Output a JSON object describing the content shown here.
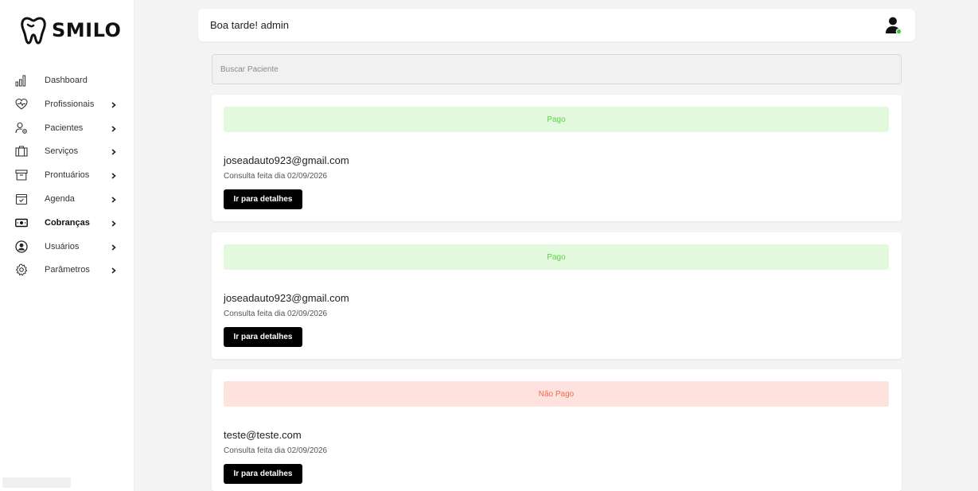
{
  "app": {
    "brand": "SMILO"
  },
  "sidebar": {
    "items": [
      {
        "label": "Dashboard",
        "icon": "bar-chart-icon",
        "has_submenu": false,
        "active": false
      },
      {
        "label": "Profissionais",
        "icon": "heart-pulse-icon",
        "has_submenu": true,
        "active": false
      },
      {
        "label": "Pacientes",
        "icon": "patient-gear-icon",
        "has_submenu": true,
        "active": false
      },
      {
        "label": "Serviços",
        "icon": "briefcase-icon",
        "has_submenu": true,
        "active": false
      },
      {
        "label": "Prontuários",
        "icon": "archive-box-icon",
        "has_submenu": true,
        "active": false
      },
      {
        "label": "Agenda",
        "icon": "calendar-check-icon",
        "has_submenu": true,
        "active": false
      },
      {
        "label": "Cobranças",
        "icon": "money-bill-icon",
        "has_submenu": true,
        "active": true
      },
      {
        "label": "Usuários",
        "icon": "user-circle-icon",
        "has_submenu": true,
        "active": false
      },
      {
        "label": "Parâmetros",
        "icon": "gear-icon",
        "has_submenu": true,
        "active": false
      }
    ]
  },
  "header": {
    "greeting": "Boa tarde! admin",
    "avatar_status_color": "#3cc84a"
  },
  "search": {
    "placeholder": "Buscar Paciente",
    "value": ""
  },
  "billing": {
    "cards": [
      {
        "status": "Pago",
        "status_type": "paid",
        "email": "joseadauto923@gmail.com",
        "date_text": "Consulta feita dia 02/09/2026",
        "button_label": "Ir para detalhes"
      },
      {
        "status": "Pago",
        "status_type": "paid",
        "email": "joseadauto923@gmail.com",
        "date_text": "Consulta feita dia 02/09/2026",
        "button_label": "Ir para detalhes"
      },
      {
        "status": "Não Pago",
        "status_type": "unpaid",
        "email": "teste@teste.com",
        "date_text": "Consulta feita dia 02/09/2026",
        "button_label": "Ir para detalhes"
      }
    ]
  },
  "colors": {
    "paid_bg": "#e3f9dd",
    "paid_text": "#5fcf48",
    "unpaid_bg": "#fde2dd",
    "unpaid_text": "#ef6a4f",
    "button_bg": "#000000",
    "page_bg": "#f4f4f4"
  }
}
